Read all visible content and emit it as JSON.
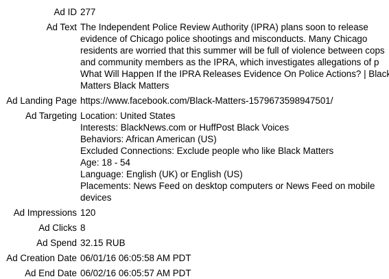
{
  "ad": {
    "id": {
      "label": "Ad ID",
      "value": "277"
    },
    "text": {
      "label": "Ad Text",
      "lines": [
        "The Independent Police Review Authority (IPRA) plans soon to release",
        "evidence of Chicago police shootings and misconducts. Many Chicago",
        "residents are worried that this summer will be full of violence between cops",
        "and community members as the IPRA, which investigates allegations of p",
        "What Will Happen If the IPRA Releases Evidence On Police Actions? | Black",
        "Matters Black Matters"
      ]
    },
    "landing_page": {
      "label": "Ad Landing Page",
      "value": "https://www.facebook.com/Black-Matters-1579673598947501/"
    },
    "targeting": {
      "label": "Ad Targeting",
      "lines": [
        "Location: United States",
        "Interests: BlackNews.com or HuffPost Black Voices",
        "Behaviors: African American (US)",
        "Excluded Connections: Exclude people who like Black Matters",
        "Age: 18 - 54",
        "Language: English (UK) or English (US)",
        "Placements: News Feed on desktop computers or News Feed on mobile",
        "devices"
      ]
    },
    "impressions": {
      "label": "Ad Impressions",
      "value": "120"
    },
    "clicks": {
      "label": "Ad Clicks",
      "value": "8"
    },
    "spend": {
      "label": "Ad Spend",
      "value": "32.15 RUB"
    },
    "creation_date": {
      "label": "Ad Creation Date",
      "value": "06/01/16 06:05:58 AM PDT"
    },
    "end_date": {
      "label": "Ad End Date",
      "value": "06/02/16 06:05:57 AM PDT"
    }
  }
}
